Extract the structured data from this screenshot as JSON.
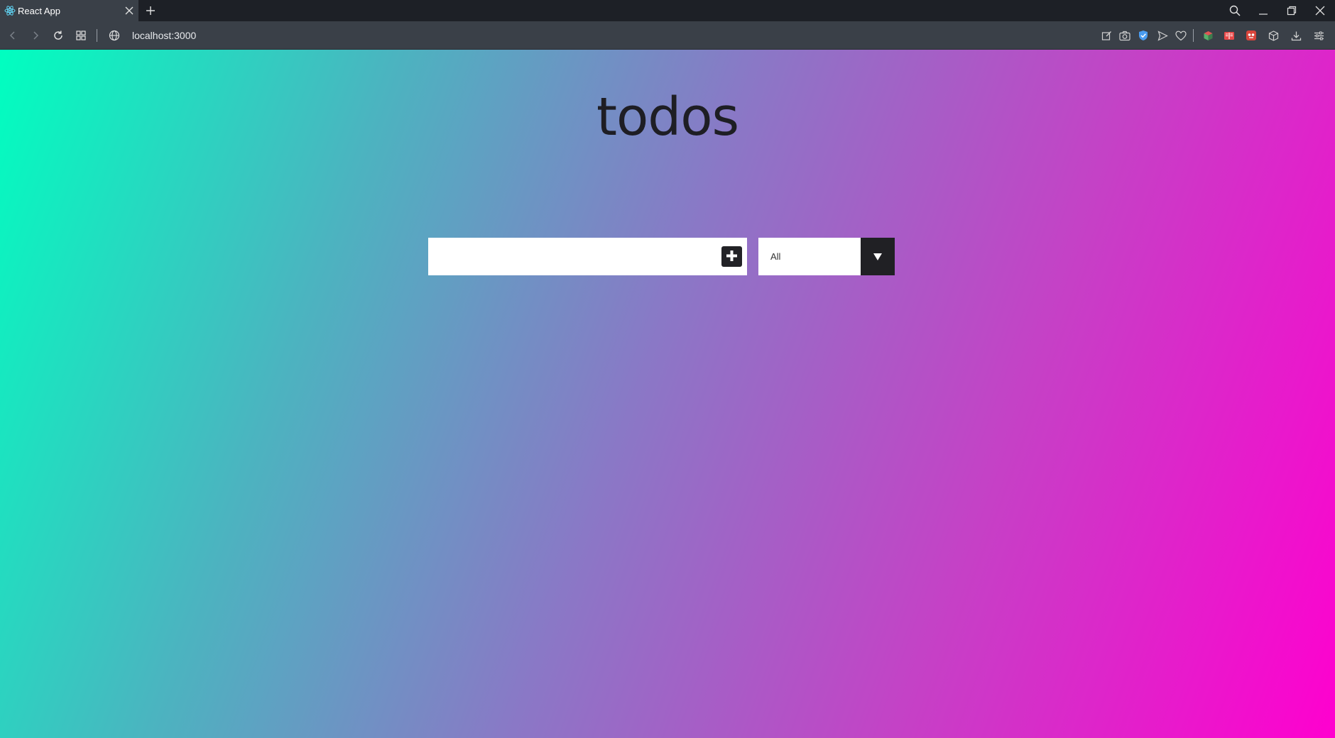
{
  "browser": {
    "tab": {
      "title": "React App",
      "favicon": "react-logo-icon"
    },
    "address": {
      "url": "localhost:3000"
    },
    "icons": {
      "back": "arrow-left-icon",
      "forward": "arrow-right-icon",
      "reload": "reload-icon",
      "tabs": "grid-icon",
      "site": "globe-icon",
      "search": "search-icon"
    }
  },
  "app": {
    "title": "todos",
    "input": {
      "value": "",
      "placeholder": ""
    },
    "filter": {
      "selected": "All"
    }
  },
  "colors": {
    "gradient_start": "#00ffc0",
    "gradient_mid": "#8a78c6",
    "gradient_end": "#ff00cf",
    "button_dark": "#222226"
  }
}
